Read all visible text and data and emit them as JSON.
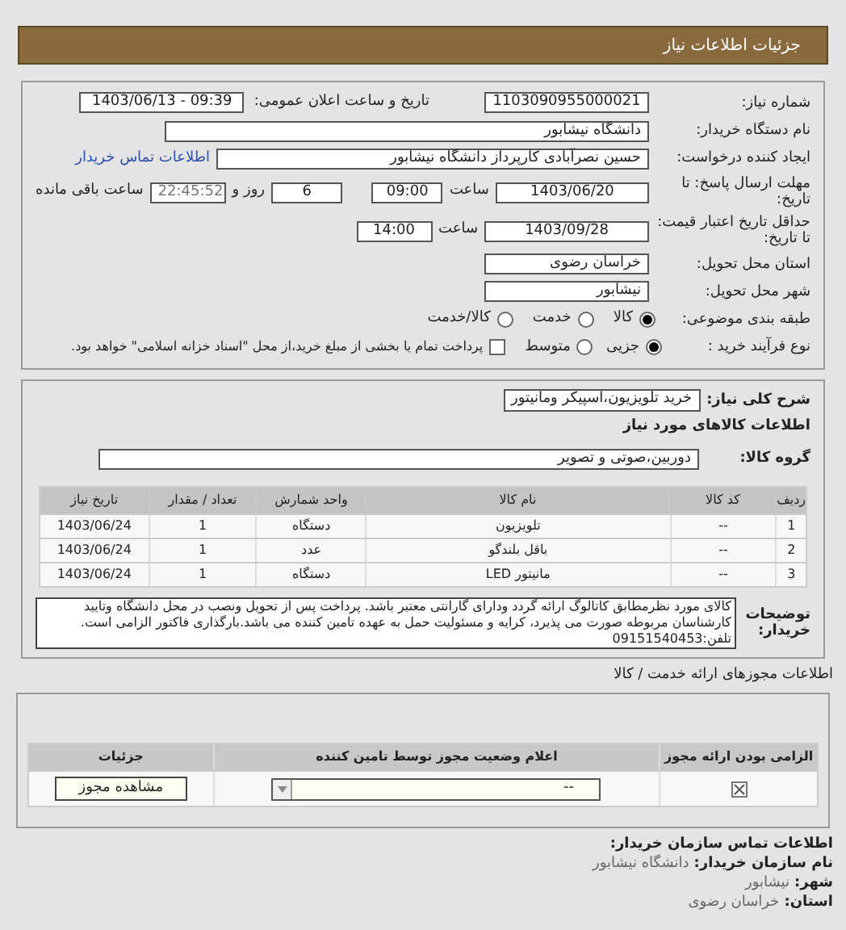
{
  "header": {
    "title": "جزئیات اطلاعات نیاز"
  },
  "need": {
    "number_label": "شماره نیاز:",
    "number": "1103090955000021",
    "announce_label": "تاریخ و ساعت اعلان عمومی:",
    "announce": "1403/06/13 - 09:39",
    "buyer_label": "نام دستگاه خریدار:",
    "buyer": "دانشگاه نیشابور",
    "creator_label": "ایجاد کننده درخواست:",
    "creator": "حسین نصرآبادی کارپرداز دانشگاه نیشابور",
    "contact_link": "اطلاعات تماس خریدار",
    "deadline_label": "مهلت ارسال پاسخ: تا تاریخ:",
    "deadline_date": "1403/06/20",
    "time_label": "ساعت",
    "deadline_time": "09:00",
    "days": "6",
    "days_label": "روز و",
    "remaining": "22:45:52",
    "remaining_label": "ساعت باقی مانده",
    "validity_label": "حداقل تاریخ اعتبار قیمت: تا تاریخ:",
    "validity_date": "1403/09/28",
    "validity_time_label": "ساعت",
    "validity_time": "14:00",
    "province_label": "استان محل تحویل:",
    "province": "خراسان رضوی",
    "city_label": "شهر محل تحویل:",
    "city": "نیشابور",
    "category_label": "طبقه بندی موضوعی:",
    "category_options": [
      {
        "label": "کالا",
        "selected": true
      },
      {
        "label": "خدمت",
        "selected": false
      },
      {
        "label": "کالا/خدمت",
        "selected": false
      }
    ],
    "process_label": "نوع فرآیند خرید :",
    "process_options": [
      {
        "label": "جزیی",
        "selected": true
      },
      {
        "label": "متوسط",
        "selected": false
      }
    ],
    "treasury": {
      "label": "پرداخت تمام یا بخشی از مبلغ خرید،از محل \"اسناد خزانه اسلامی\" خواهد بود.",
      "checked": false
    }
  },
  "goods": {
    "summary_label": "شرح کلی نیاز:",
    "summary": "خرید تلویزیون،اسپیکر ومانیتور",
    "section_title": "اطلاعات کالاهای مورد نیاز",
    "group_label": "گروه کالا:",
    "group": "دوربین،صوتی و تصویر",
    "columns": [
      "ردیف",
      "کد کالا",
      "نام کالا",
      "واحد شمارش",
      "تعداد / مقدار",
      "تاریخ نیاز"
    ],
    "rows": [
      [
        "1",
        "--",
        "تلویزیون",
        "دستگاه",
        "1",
        "1403/06/24"
      ],
      [
        "2",
        "--",
        "باقل بلندگو",
        "عدد",
        "1",
        "1403/06/24"
      ],
      [
        "3",
        "--",
        "مانیتور LED",
        "دستگاه",
        "1",
        "1403/06/24"
      ]
    ],
    "notes_label": "توضیحات خریدار:",
    "notes": "کالای مورد نظرمطابق کاتالوگ ارائه گردد ودارای گارانتی معتبر باشد. پرداخت پس از تحویل ونصب در محل دانشگاه وتایید کارشناسان مربوطه صورت می پذیرد، کرایه و مسئولیت حمل به عهده تامین کننده می باشد.بارگذاری فاکتور الزامی است. تلفن:09151540453"
  },
  "permits": {
    "title": "اطلاعات مجوزهای ارائه خدمت / کالا",
    "columns": [
      "الزامی بودن ارائه مجوز",
      "اعلام وضعیت مجوز توسط تامین کننده",
      "جزئیات"
    ],
    "rows": [
      {
        "required": true,
        "status": "--",
        "button": "مشاهده مجوز"
      }
    ]
  },
  "contact": {
    "title": "اطلاعات تماس سازمان خریدار:",
    "items": [
      {
        "label": "نام سازمان خریدار:",
        "value": "دانشگاه نیشابور"
      },
      {
        "label": "شهر:",
        "value": "نیشابور"
      },
      {
        "label": "استان:",
        "value": "خراسان رضوی"
      }
    ]
  }
}
